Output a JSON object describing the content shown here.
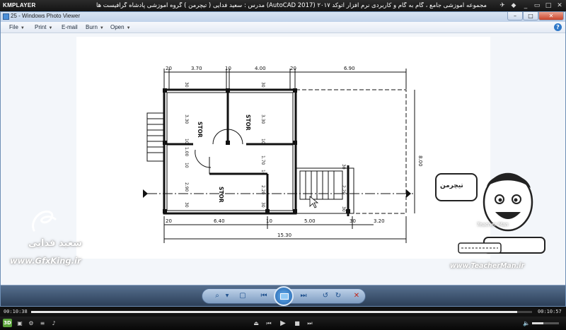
{
  "kmplayer": {
    "logo": "KMPLAYER",
    "title": "مجموعه آموزشی جامع ، گام به گام و کاربردی نرم افزار اتوکد ۲۰۱۷ (AutoCAD 2017)  مدرس : سعید فدایی ( تیچرمن ) گروه آموزشی پادشاه گرافیست ها",
    "time_elapsed": "00:10:38",
    "time_total": "00:10:57",
    "progress": 0.97,
    "volume": 0.42,
    "badge_3d": "3D"
  },
  "viewer": {
    "title": "25 - Windows Photo Viewer",
    "menu": [
      "File",
      "Print",
      "E-mail",
      "Burn",
      "Open"
    ],
    "help": "?"
  },
  "drawing": {
    "top_dims": [
      "20",
      "3.70",
      "10",
      "4.00",
      "20",
      "6.90"
    ],
    "bottom_dims": [
      "20",
      "6.40",
      "10",
      "5.00",
      "30",
      "3.20"
    ],
    "overall": "15.30",
    "right_dim": "8.00",
    "rooms": [
      "STOR",
      "STOR",
      "STOR"
    ],
    "vdims": [
      "30",
      "3.30",
      "10",
      "1.00",
      "10",
      "2.90",
      "30"
    ],
    "vdims2": [
      "30",
      "3.30",
      "10",
      "1.70",
      "10",
      "2.20",
      "30"
    ],
    "vdims3": [
      "30",
      "2.20",
      "30"
    ]
  },
  "watermarks": {
    "name": "سعید فدایی",
    "site_left": "www.GfxKing.ir",
    "site_right": "www.TeacherMan.ir",
    "badge": "تیچرمن",
    "badge_en": "Teacher Man"
  }
}
